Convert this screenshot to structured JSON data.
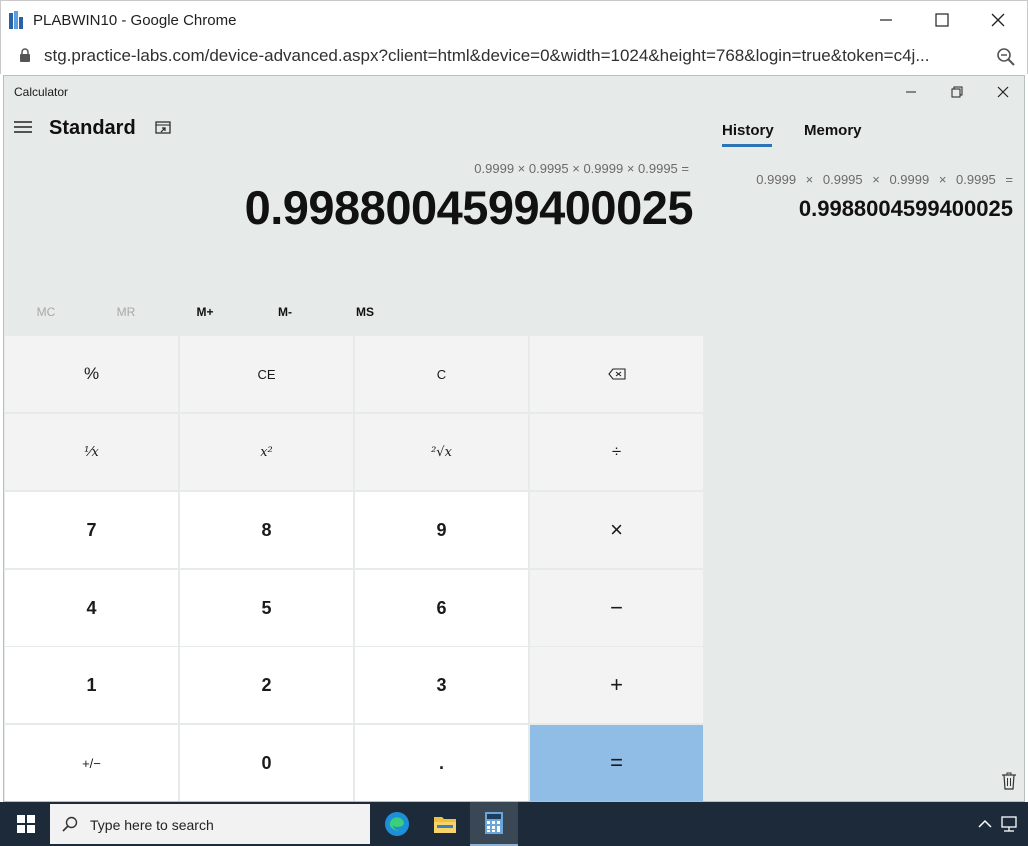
{
  "browser": {
    "title": "PLABWIN10 - Google Chrome",
    "url": "stg.practice-labs.com/device-advanced.aspx?client=html&device=0&width=1024&height=768&login=true&token=c4j..."
  },
  "calculator": {
    "window_title": "Calculator",
    "mode": "Standard",
    "expression": "0.9999 × 0.9995 × 0.9999 × 0.9995 =",
    "result": "0.9988004599400025",
    "memory_buttons": [
      "MC",
      "MR",
      "M+",
      "M-",
      "MS"
    ],
    "keys": {
      "percent": "%",
      "ce": "CE",
      "c": "C",
      "reciprocal": "⅟x",
      "square": "x²",
      "sqrt": "²√x",
      "divide": "÷",
      "seven": "7",
      "eight": "8",
      "nine": "9",
      "multiply": "×",
      "four": "4",
      "five": "5",
      "six": "6",
      "minus": "−",
      "one": "1",
      "two": "2",
      "three": "3",
      "plus": "+",
      "negate": "+/−",
      "zero": "0",
      "decimal": ".",
      "equals": "="
    },
    "tabs": {
      "history": "History",
      "memory": "Memory"
    },
    "history": {
      "expression": "0.9999 × 0.9995 × 0.9999 × 0.9995 =",
      "result": "0.9988004599400025"
    }
  },
  "taskbar": {
    "search_placeholder": "Type here to search"
  },
  "colors": {
    "equals_key": "#8fbde6",
    "calc_bg": "#e6eae8",
    "tab_underline": "#2c74b3",
    "taskbar": "#1c2a3a"
  }
}
